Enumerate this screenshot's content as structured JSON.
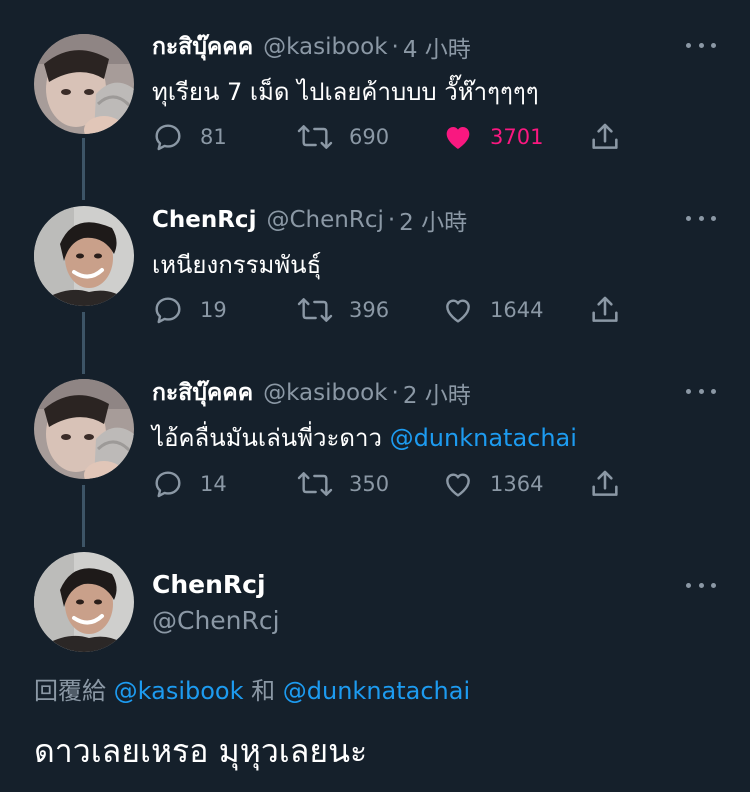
{
  "tweets": [
    {
      "name": "กะสิบุ๊คคค",
      "handle": "@kasibook",
      "dot": "·",
      "time": "4 小時",
      "text": "ทุเรียน 7 เม็ด ไปเลยค้าบบบ วั๊ห๊าๆๆๆๆ",
      "mention": "",
      "replies": "81",
      "retweets": "690",
      "likes": "3701",
      "liked": true,
      "avatar": "avatar-kasibook"
    },
    {
      "name": "ChenRcj",
      "handle": "@ChenRcj",
      "dot": "·",
      "time": "2 小時",
      "text": "เหนียงกรรมพันธุ์",
      "mention": "",
      "replies": "19",
      "retweets": "396",
      "likes": "1644",
      "liked": false,
      "avatar": "avatar-chenrcj"
    },
    {
      "name": "กะสิบุ๊คคค",
      "handle": "@kasibook",
      "dot": "·",
      "time": "2 小時",
      "text": "ไอ้คลื่นมันเล่นพี่วะดาว ",
      "mention": "@dunknatachai",
      "replies": "14",
      "retweets": "350",
      "likes": "1364",
      "liked": false,
      "avatar": "avatar-kasibook"
    }
  ],
  "main_tweet": {
    "name": "ChenRcj",
    "handle": "@ChenRcj",
    "reply_prefix": "回覆給 ",
    "reply_mention_1": "@kasibook",
    "reply_conj": " 和 ",
    "reply_mention_2": "@dunknatachai",
    "text": "ดาวเลยเหรอ มุหุวเลยนะ"
  },
  "colors": {
    "background": "#15202b",
    "secondary_text": "#8b98a5",
    "link": "#1d9bf0",
    "like_active": "#f91880",
    "thread_line": "#3d5466"
  }
}
